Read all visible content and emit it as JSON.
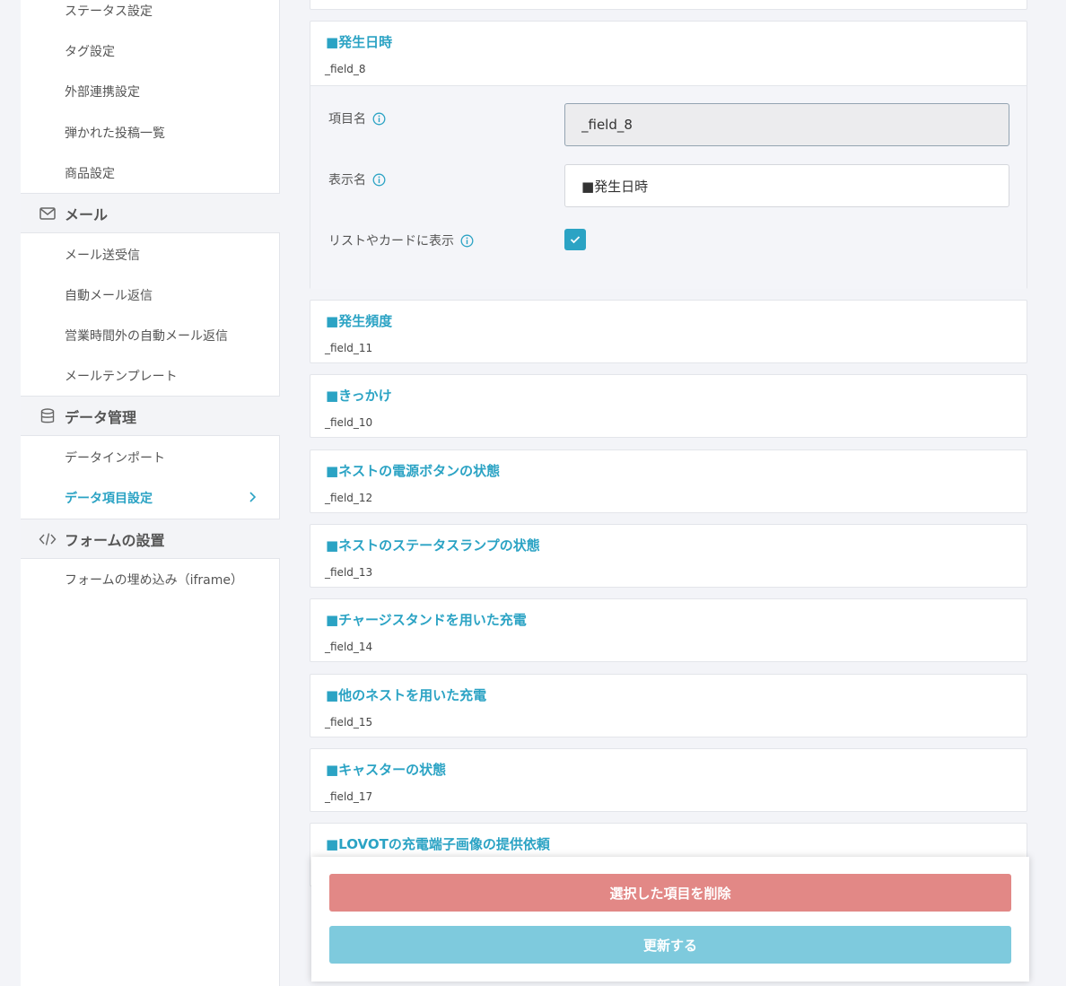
{
  "sidebar": {
    "top_items": [
      {
        "label": "ステータス設定"
      },
      {
        "label": "タグ設定"
      },
      {
        "label": "外部連携設定"
      },
      {
        "label": "弾かれた投稿一覧"
      },
      {
        "label": "商品設定"
      }
    ],
    "mail": {
      "title": "メール",
      "items": [
        {
          "label": "メール送受信"
        },
        {
          "label": "自動メール返信"
        },
        {
          "label": "営業時間外の自動メール返信"
        },
        {
          "label": "メールテンプレート"
        }
      ]
    },
    "data": {
      "title": "データ管理",
      "items": [
        {
          "label": "データインポート"
        },
        {
          "label": "データ項目設定"
        }
      ]
    },
    "form": {
      "title": "フォームの設置",
      "items": [
        {
          "label": "フォームの埋め込み（iframe）"
        }
      ]
    }
  },
  "expanded_field": {
    "title": "■発生日時",
    "key": "_field_8",
    "labels": {
      "item_name": "項目名",
      "display_name": "表示名",
      "show_in_list": "リストやカードに表示"
    },
    "values": {
      "item_name": "_field_8",
      "display_name": "■発生日時",
      "show_in_list": true
    }
  },
  "fields": [
    {
      "title": "■発生頻度",
      "key": "_field_11"
    },
    {
      "title": "■きっかけ",
      "key": "_field_10"
    },
    {
      "title": "■ネストの電源ボタンの状態",
      "key": "_field_12"
    },
    {
      "title": "■ネストのステータスランプの状態",
      "key": "_field_13"
    },
    {
      "title": "■チャージスタンドを用いた充電",
      "key": "_field_14"
    },
    {
      "title": "■他のネストを用いた充電",
      "key": "_field_15"
    },
    {
      "title": "■キャスターの状態",
      "key": "_field_17"
    },
    {
      "title": "■LOVOTの充電端子画像の提供依頼",
      "key": ""
    }
  ],
  "actions": {
    "delete_label": "選択した項目を削除",
    "update_label": "更新する"
  },
  "colors": {
    "accent": "#2ba3c4",
    "delete": "#e28886",
    "update": "#7ecadd"
  }
}
